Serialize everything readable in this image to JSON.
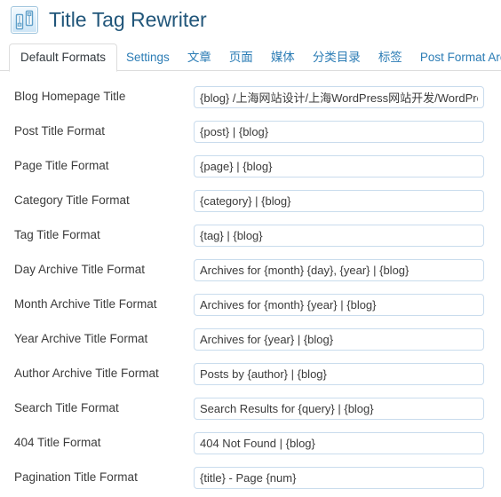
{
  "header": {
    "icon": "sliders-icon",
    "title": "Title Tag Rewriter"
  },
  "tabs": [
    {
      "label": "Default Formats",
      "active": true,
      "name": "tab-default-formats"
    },
    {
      "label": "Settings",
      "active": false,
      "name": "tab-settings"
    },
    {
      "label": "文章",
      "active": false,
      "name": "tab-posts"
    },
    {
      "label": "页面",
      "active": false,
      "name": "tab-pages"
    },
    {
      "label": "媒体",
      "active": false,
      "name": "tab-media"
    },
    {
      "label": "分类目录",
      "active": false,
      "name": "tab-categories"
    },
    {
      "label": "标签",
      "active": false,
      "name": "tab-tags"
    },
    {
      "label": "Post Format Archives",
      "active": false,
      "name": "tab-post-format-archives"
    }
  ],
  "form": {
    "fields": [
      {
        "label": "Blog Homepage Title",
        "value": "{blog} /上海网站设计/上海WordPress网站开发/WordPress",
        "name": "blog-homepage-title"
      },
      {
        "label": "Post Title Format",
        "value": "{post} | {blog}",
        "name": "post-title-format"
      },
      {
        "label": "Page Title Format",
        "value": "{page} | {blog}",
        "name": "page-title-format"
      },
      {
        "label": "Category Title Format",
        "value": "{category} | {blog}",
        "name": "category-title-format"
      },
      {
        "label": "Tag Title Format",
        "value": "{tag} | {blog}",
        "name": "tag-title-format"
      },
      {
        "label": "Day Archive Title Format",
        "value": "Archives for {month} {day}, {year} | {blog}",
        "name": "day-archive-title-format"
      },
      {
        "label": "Month Archive Title Format",
        "value": "Archives for {month} {year} | {blog}",
        "name": "month-archive-title-format"
      },
      {
        "label": "Year Archive Title Format",
        "value": "Archives for {year} | {blog}",
        "name": "year-archive-title-format"
      },
      {
        "label": "Author Archive Title Format",
        "value": "Posts by {author} | {blog}",
        "name": "author-archive-title-format"
      },
      {
        "label": "Search Title Format",
        "value": "Search Results for {query} | {blog}",
        "name": "search-title-format"
      },
      {
        "label": "404 Title Format",
        "value": "404 Not Found | {blog}",
        "name": "404-title-format"
      },
      {
        "label": "Pagination Title Format",
        "value": "{title} - Page {num}",
        "name": "pagination-title-format"
      }
    ]
  },
  "colors": {
    "title": "#21567a",
    "tab_link": "#2b7cb5",
    "tab_active_text": "#31383d",
    "input_border": "#c9dced",
    "rule": "#dddddd"
  }
}
